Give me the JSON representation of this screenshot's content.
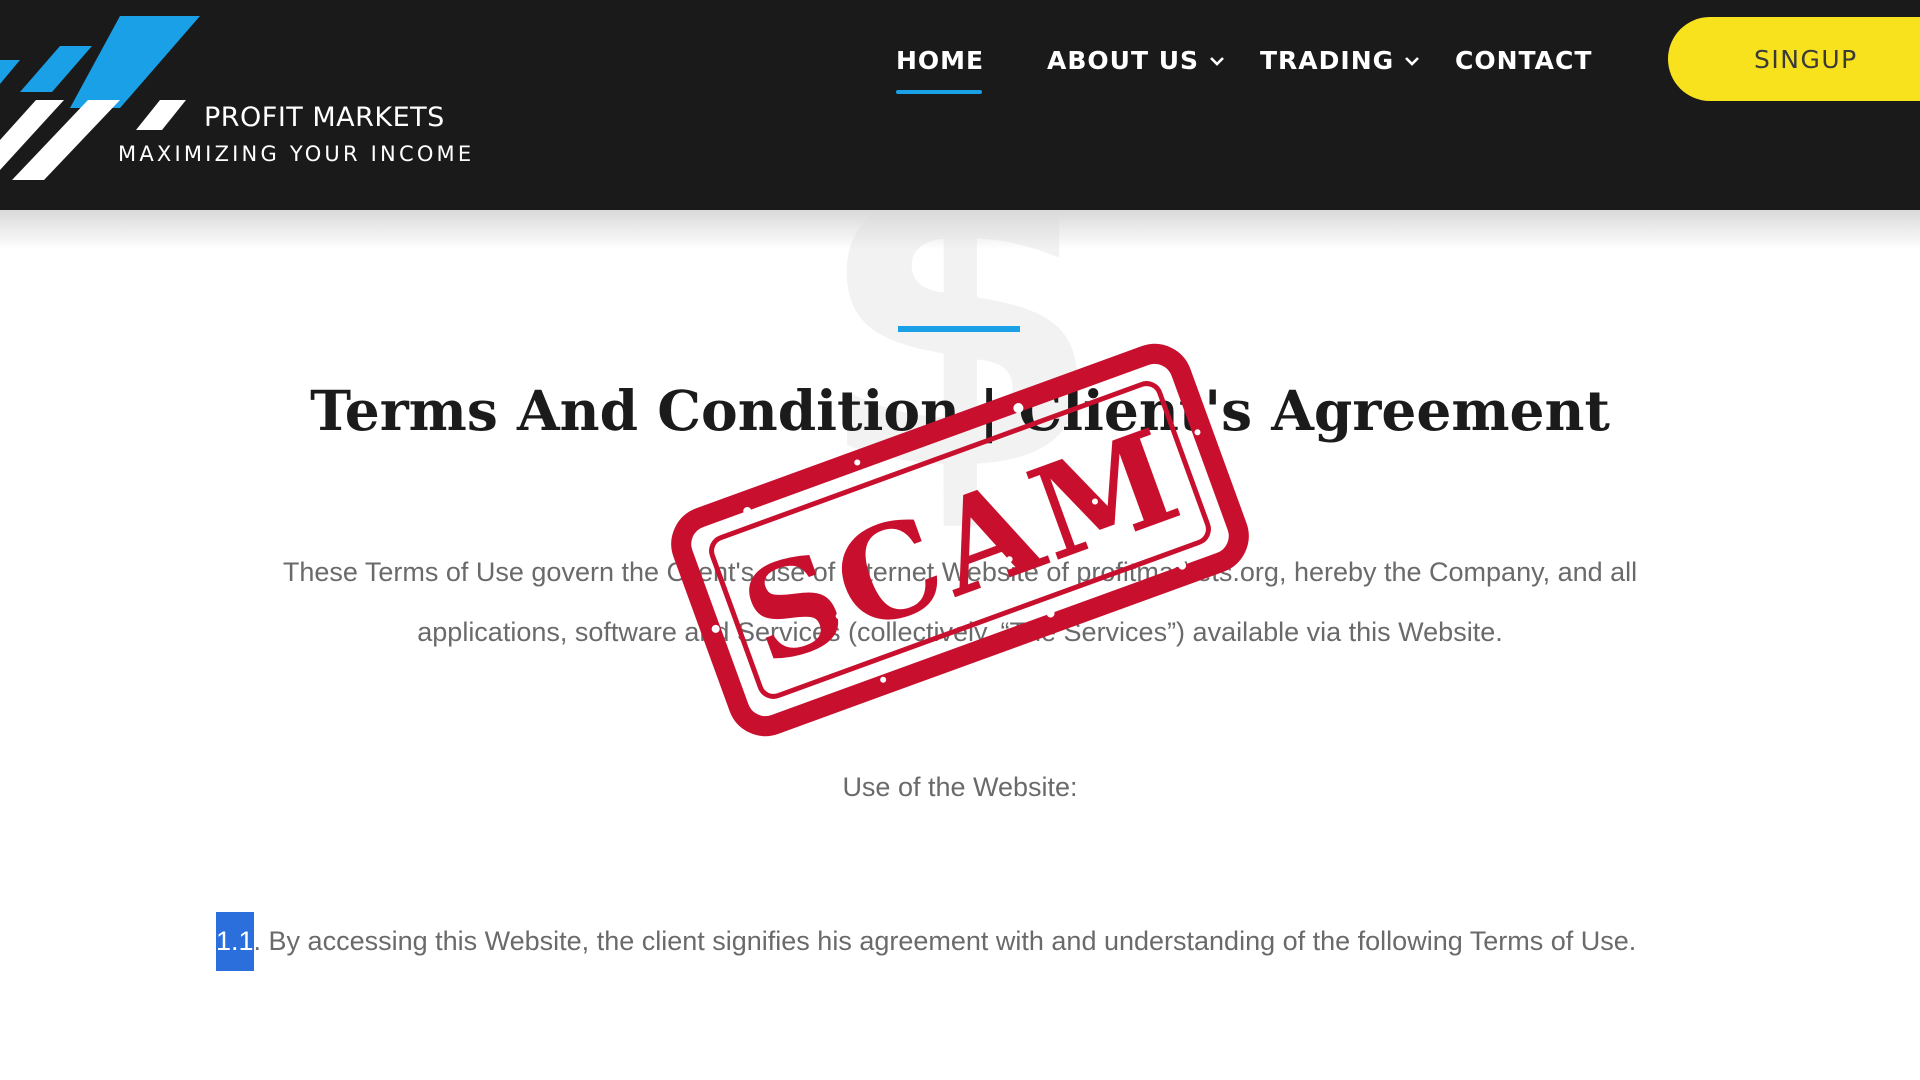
{
  "brand": {
    "name": "PROFIT MARKETS",
    "tagline": "MAXIMIZING YOUR INCOME",
    "colors": {
      "header_bg": "#1b1a1a",
      "accent_blue": "#1aa0e6",
      "signup_yellow": "#f8e21e",
      "stamp_red": "#c8102e"
    }
  },
  "nav": {
    "items": [
      {
        "label": "HOME",
        "active": true,
        "has_dropdown": false
      },
      {
        "label": "ABOUT US",
        "active": false,
        "has_dropdown": true
      },
      {
        "label": "TRADING",
        "active": false,
        "has_dropdown": true
      },
      {
        "label": "CONTACT",
        "active": false,
        "has_dropdown": false
      }
    ],
    "signup_label": "SINGUP"
  },
  "content": {
    "watermark_glyph": "$",
    "title": "Terms And Condition | Client's Agreement",
    "paragraph_line1": "These Terms of Use govern the Client's use of Internet Website of profitmarkets.org, hereby the Company, and all",
    "paragraph_line2": "applications, software and Services (collectively, “The Services”) available via this Website.",
    "section_heading": "Use of the Website:",
    "clause_number": "1.1",
    "clause_text": ". By accessing this Website, the client signifies his agreement with and understanding of the following Terms of Use."
  },
  "stamp": {
    "text": "SCAM"
  }
}
